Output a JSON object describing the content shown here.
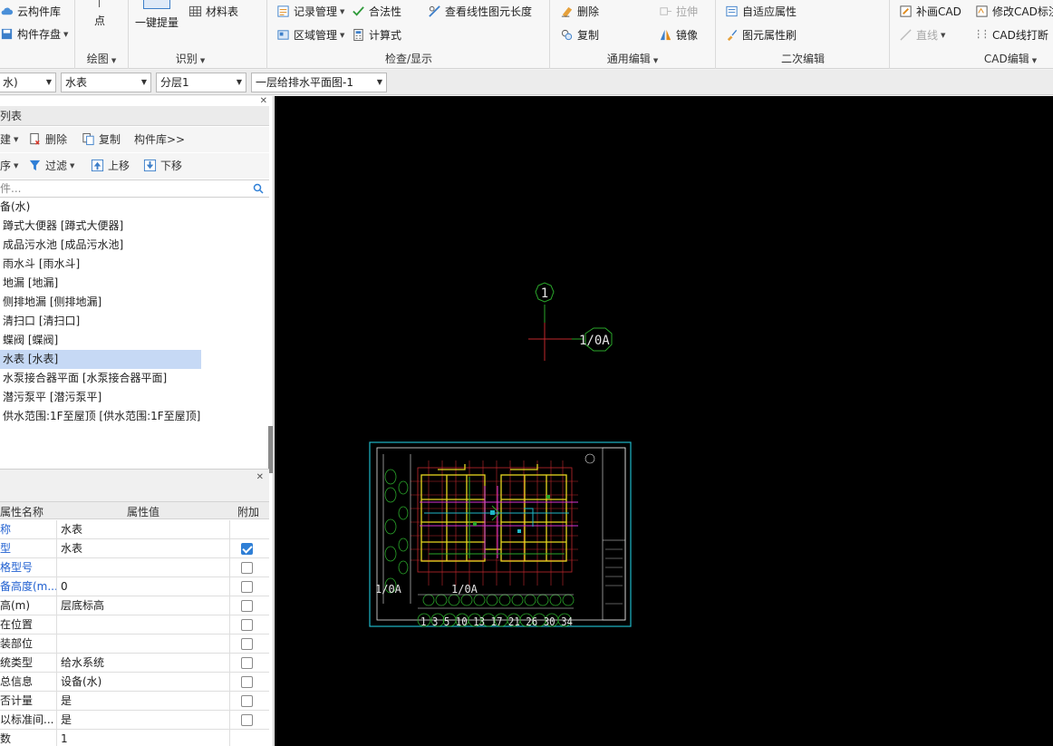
{
  "ribbon": {
    "cloud_lib": "云构件库",
    "comp_save": "构件存盘",
    "point": "点",
    "one_key": "一键提量",
    "material_table": "材料表",
    "group_draw": "绘图",
    "group_identify": "识别",
    "record_mgmt": "记录管理",
    "validity": "合法性",
    "view_length": "查看线性图元长度",
    "area_mgmt": "区域管理",
    "calc_formula": "计算式",
    "group_check": "检查/显示",
    "delete": "删除",
    "stretch": "拉伸",
    "copy": "复制",
    "mirror": "镜像",
    "group_general": "通用编辑",
    "adaptive_attr": "自适应属性",
    "attr_brush": "图元属性刷",
    "group_secondary": "二次编辑",
    "redraw_cad": "补画CAD",
    "modify_cad_label": "修改CAD标注",
    "line": "直线",
    "cad_break": "CAD线打断",
    "group_cad": "CAD编辑"
  },
  "selectors": {
    "discipline": "水)",
    "component_type": "水表",
    "floor": "分层1",
    "drawing": "一层给排水平面图-1"
  },
  "component_list": {
    "title": "列表",
    "new": "建",
    "delete": "删除",
    "copy": "复制",
    "library": "构件库>>",
    "sort": "序",
    "filter": "过滤",
    "move_up": "上移",
    "move_down": "下移",
    "search_placeholder": "件...",
    "category": "备(水)",
    "items": [
      "蹲式大便器 [蹲式大便器]",
      "成品污水池 [成品污水池]",
      "雨水斗 [雨水斗]",
      "地漏 [地漏]",
      "侧排地漏 [侧排地漏]",
      "清扫口 [清扫口]",
      "蝶阀 [蝶阀]",
      "水表 [水表]",
      "水泵接合器平面 [水泵接合器平面]",
      "潜污泵平 [潜污泵平]",
      "供水范围:1F至屋顶 [供水范围:1F至屋顶]"
    ],
    "selected_index": 7
  },
  "properties": {
    "headers": {
      "name": "属性名称",
      "value": "属性值",
      "extra": "附加"
    },
    "rows": [
      {
        "name": "称",
        "value": "水表",
        "checked": null,
        "blue": true
      },
      {
        "name": "型",
        "value": "水表",
        "checked": true,
        "blue": true
      },
      {
        "name": "格型号",
        "value": "",
        "checked": false,
        "blue": true
      },
      {
        "name": "备高度(m...",
        "value": "0",
        "checked": false,
        "blue": true
      },
      {
        "name": "高(m)",
        "value": "层底标高",
        "checked": false,
        "blue": false
      },
      {
        "name": "在位置",
        "value": "",
        "checked": false,
        "blue": false
      },
      {
        "name": "装部位",
        "value": "",
        "checked": false,
        "blue": false
      },
      {
        "name": "统类型",
        "value": "给水系统",
        "checked": false,
        "blue": false
      },
      {
        "name": "总信息",
        "value": "设备(水)",
        "checked": false,
        "blue": false
      },
      {
        "name": "否计量",
        "value": "是",
        "checked": false,
        "blue": false
      },
      {
        "name": "以标准间...",
        "value": "是",
        "checked": false,
        "blue": false
      },
      {
        "name": "数",
        "value": "1",
        "checked": null,
        "blue": false
      }
    ]
  },
  "canvas": {
    "axis_number": "1",
    "axis_label": "1/0A",
    "plan_axis_labels": "1 3 5 10 13 17 21 26 30 34",
    "plan_side_label": "1/0A",
    "plan_mid_label": "1/0A"
  },
  "colors": {
    "canvas_bg": "#000000",
    "selection": "#c6d9f5",
    "label_blue": "#1f5fd0"
  }
}
